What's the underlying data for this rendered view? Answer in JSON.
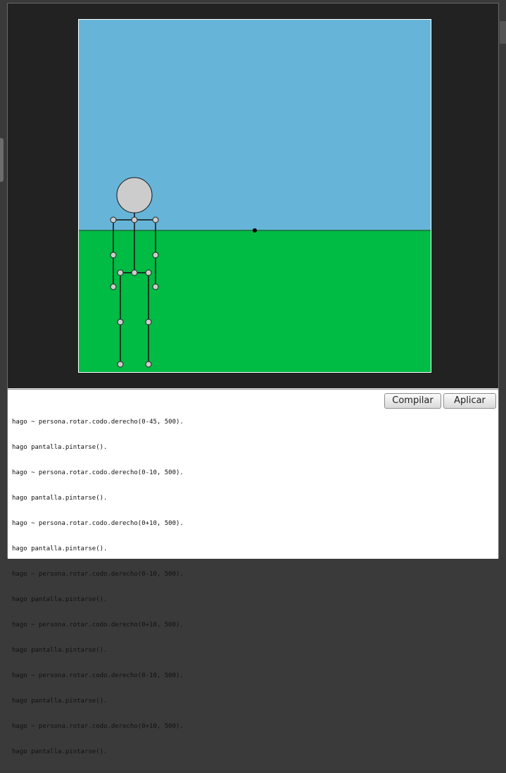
{
  "colors": {
    "sky": "#66b5d8",
    "ground": "#00bb44",
    "horizon": "#1d6b3a",
    "joint_fill": "#cccccc",
    "bone": "#111111",
    "head": "#cccccc"
  },
  "editor": {
    "compile_label": "Compilar",
    "apply_label": "Aplicar",
    "lines": [
      "hago ~ persona.rotar.codo.derecho(0-45, 500).",
      "hago pantalla.pintarse().",
      "hago ~ persona.rotar.codo.derecho(0-10, 500).",
      "hago pantalla.pintarse().",
      "hago ~ persona.rotar.codo.derecho(0+10, 500).",
      "hago pantalla.pintarse().",
      "hago ~ persona.rotar.codo.derecho(0-10, 500).",
      "hago pantalla.pintarse().",
      "hago ~ persona.rotar.codo.derecho(0+10, 500).",
      "hago pantalla.pintarse().",
      "hago ~ persona.rotar.codo.derecho(0-10, 500).",
      "hago pantalla.pintarse().",
      "hago ~ persona.rotar.codo.derecho(0+10, 500).",
      "hago pantalla.pintarse()."
    ]
  }
}
